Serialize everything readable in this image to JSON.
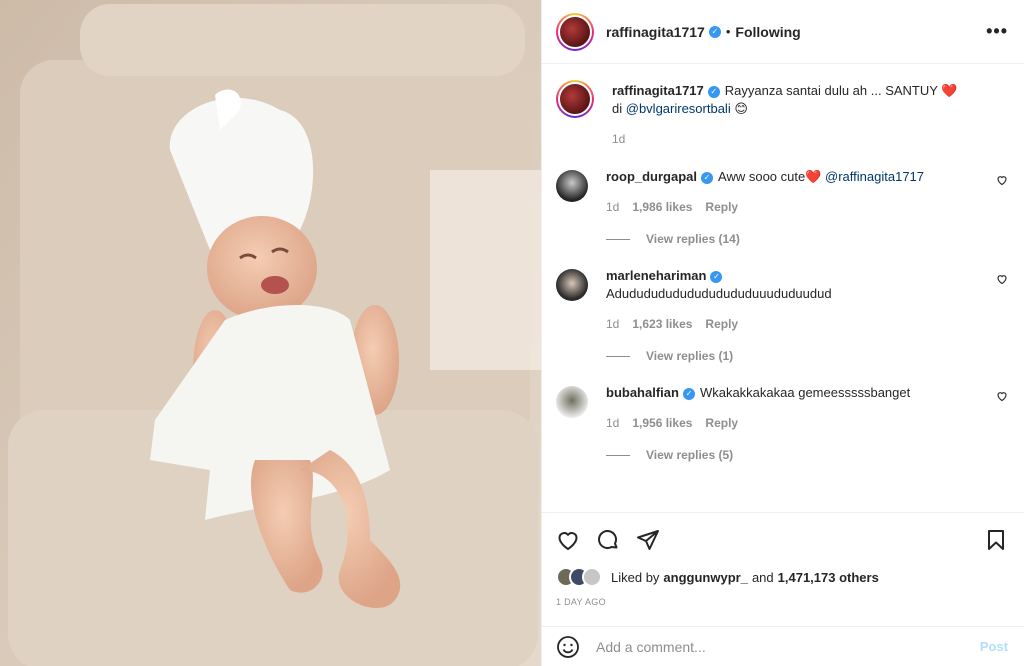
{
  "post": {
    "username": "raffinagita1717",
    "follow_status": "Following",
    "separator": "•",
    "more": "•••"
  },
  "caption": {
    "username": "raffinagita1717",
    "text_1": "Rayyanza santai dulu ah ... SANTUY ❤️",
    "text_2_prefix": "di",
    "mention": "@bvlgariresortbali",
    "emoji": "😊",
    "time": "1d"
  },
  "comments": [
    {
      "username": "roop_durgapal",
      "text": "Aww sooo cute❤️",
      "mention": "@raffinagita1717",
      "time": "1d",
      "likes": "1,986 likes",
      "reply": "Reply",
      "view_replies": "View replies (14)"
    },
    {
      "username": "marlenehariman",
      "text": "Adudududududududududuuududuudud",
      "mention": "",
      "time": "1d",
      "likes": "1,623 likes",
      "reply": "Reply",
      "view_replies": "View replies (1)"
    },
    {
      "username": "bubahalfian",
      "text": "Wkakakkakakaa gemeesssssbanget",
      "mention": "",
      "time": "1d",
      "likes": "1,956 likes",
      "reply": "Reply",
      "view_replies": "View replies (5)"
    }
  ],
  "likes": {
    "prefix": "Liked by",
    "user": "anggunwypr_",
    "and": "and",
    "others": "1,471,173 others"
  },
  "date": "1 DAY AGO",
  "add_comment": {
    "placeholder": "Add a comment...",
    "post": "Post"
  },
  "icons": {
    "more": "more-options-icon",
    "verified": "verified-badge-icon",
    "like": "heart-icon",
    "comment": "comment-icon",
    "share": "share-icon",
    "save": "bookmark-icon",
    "emoji": "emoji-icon"
  },
  "colors": {
    "verified": "#3897f0",
    "link": "#00376b",
    "muted": "#8e8e8e",
    "post_disabled": "#b2dffc"
  }
}
